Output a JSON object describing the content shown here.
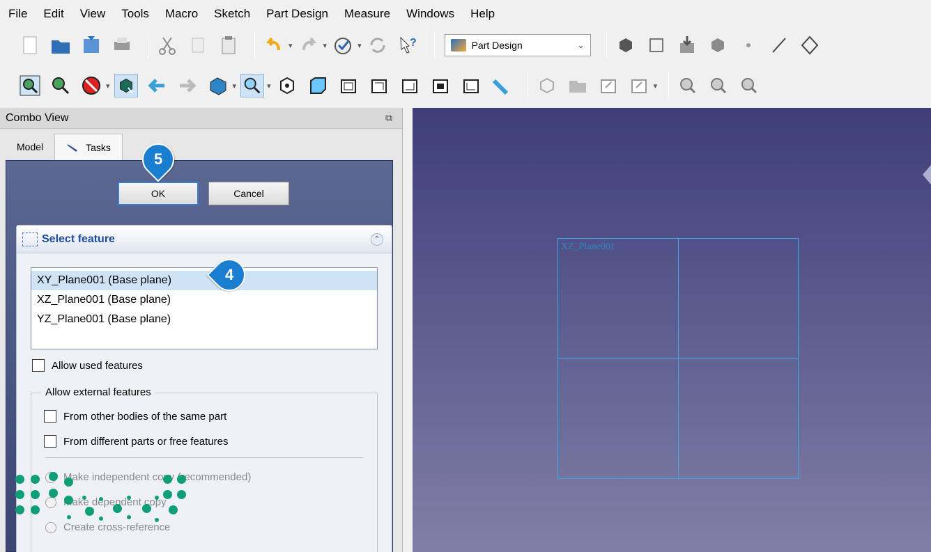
{
  "menubar": {
    "items": [
      "File",
      "Edit",
      "View",
      "Tools",
      "Macro",
      "Sketch",
      "Part Design",
      "Measure",
      "Windows",
      "Help"
    ]
  },
  "toolbar": {
    "workbench_selected": "Part Design"
  },
  "combo_view": {
    "title": "Combo View",
    "tabs": [
      {
        "label": "Model",
        "active": false
      },
      {
        "label": "Tasks",
        "active": true
      }
    ]
  },
  "task": {
    "ok_label": "OK",
    "cancel_label": "Cancel",
    "select_feature_title": "Select feature",
    "features": [
      {
        "label": "XY_Plane001 (Base plane)",
        "selected": true
      },
      {
        "label": "XZ_Plane001 (Base plane)",
        "selected": false
      },
      {
        "label": "YZ_Plane001 (Base plane)",
        "selected": false
      }
    ],
    "allow_used_features": "Allow used features",
    "allow_external_title": "Allow external features",
    "from_other_bodies": "From other bodies of the same part",
    "from_different_parts": "From different parts or free features",
    "radio_independent": "Make independent copy (recommended)",
    "radio_dependent": "Make dependent copy",
    "radio_crossref": "Create cross-reference"
  },
  "viewport": {
    "plane_label": "XZ_Plane001"
  },
  "callouts": {
    "step5": "5",
    "step4": "4"
  },
  "colors": {
    "accent": "#1a7ed0",
    "viewport_top": "#3e3d7a",
    "viewport_bottom": "#7f7fa6",
    "plane_line": "#3aa7e8",
    "logo_green": "#0f9d7a"
  }
}
